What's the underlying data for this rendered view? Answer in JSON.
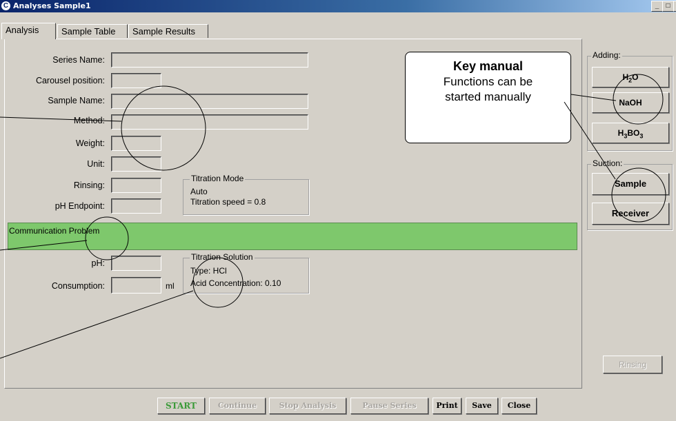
{
  "window": {
    "title": "Analyses Sample1",
    "app_icon": "title-app-icon",
    "controls": [
      "_",
      "□",
      "×"
    ]
  },
  "tabs": [
    {
      "label": "Analysis",
      "active": true
    },
    {
      "label": "Sample Table",
      "active": false
    },
    {
      "label": "Sample Results",
      "active": false
    }
  ],
  "form": {
    "series_name_label": "Series Name:",
    "carousel_label": "Carousel position:",
    "sample_name_label": "Sample Name:",
    "method_label": "Method:",
    "weight_label": "Weight:",
    "unit_label": "Unit:",
    "rinsing_label": "Rinsing:",
    "ph_endpoint_label": "pH Endpoint:",
    "ph_label": "pH:",
    "consumption_label": "Consumption:",
    "consumption_unit": "ml"
  },
  "titration_mode": {
    "title": "Titration Mode",
    "line1": "Auto",
    "line2": "Titration speed = 0.8"
  },
  "status": {
    "message": "Communication Problem",
    "color": "#7ec86c"
  },
  "titration_solution": {
    "title": "Titration Solution",
    "line1": "Type: HCl",
    "line2": "Acid Concentration: 0.10"
  },
  "callout": {
    "title": "Key manual",
    "line1": "Functions can be",
    "line2": "started manually"
  },
  "adding": {
    "title": "Adding:",
    "h2o": "H2O",
    "naoh": "NaOH",
    "h3bo3": "H3BO3"
  },
  "suction": {
    "title": "Suction:",
    "sample": "Sample",
    "receiver": "Receiver"
  },
  "rinsing_button": "Rinsing",
  "bottom_buttons": {
    "start": "START",
    "continue": "Continue",
    "stop": "Stop Analysis",
    "pause": "Pause Series",
    "print": "Print",
    "save": "Save",
    "close": "Close"
  }
}
